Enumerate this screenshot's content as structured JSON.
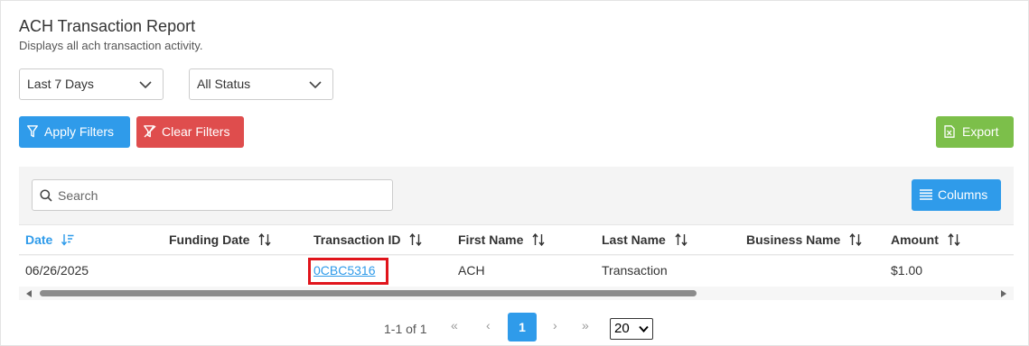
{
  "header": {
    "title": "ACH Transaction Report",
    "subtitle": "Displays all ach transaction activity."
  },
  "filters": {
    "date_range": "Last 7 Days",
    "status": "All Status"
  },
  "actions": {
    "apply_label": "Apply Filters",
    "clear_label": "Clear Filters",
    "export_label": "Export",
    "columns_label": "Columns"
  },
  "search": {
    "placeholder": "Search"
  },
  "table": {
    "columns": [
      "Date",
      "Funding Date",
      "Transaction ID",
      "First Name",
      "Last Name",
      "Business Name",
      "Amount"
    ],
    "rows": [
      {
        "date": "06/26/2025",
        "funding_date": "",
        "transaction_id": "0CBC5316",
        "first_name": "ACH",
        "last_name": "Transaction",
        "business_name": "",
        "amount": "$1.00"
      }
    ]
  },
  "pagination": {
    "info": "1-1 of 1",
    "first": "«",
    "prev": "‹",
    "current": "1",
    "next": "›",
    "last": "»",
    "page_size": "20"
  },
  "colors": {
    "primary": "#2f9bea",
    "danger": "#df4d4d",
    "success": "#7cbf4a",
    "highlight": "#e0141b"
  }
}
